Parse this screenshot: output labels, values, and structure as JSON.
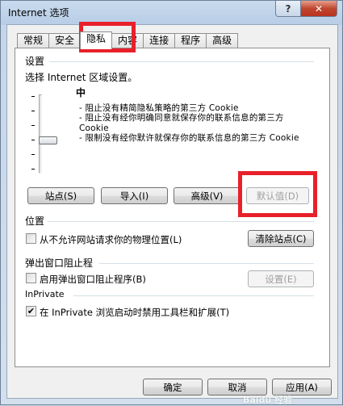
{
  "window": {
    "title": "Internet 选项",
    "help_label": "?",
    "close_label": "✕"
  },
  "tabs": [
    {
      "label": "常规"
    },
    {
      "label": "安全"
    },
    {
      "label": "隐私",
      "active": true
    },
    {
      "label": "内容"
    },
    {
      "label": "连接"
    },
    {
      "label": "程序"
    },
    {
      "label": "高级"
    }
  ],
  "settings": {
    "heading": "设置",
    "zone_prompt": "选择 Internet 区域设置。",
    "level": "中",
    "description": [
      "- 阻止没有精简隐私策略的第三方 Cookie",
      "- 阻止没有经你明确同意就保存你的联系信息的第三方 Cookie",
      "- 限制没有经你默许就保存你的联系信息的第三方 Cookie"
    ],
    "buttons": {
      "sites": "站点(S)",
      "import": "导入(I)",
      "advanced": "高级(V)",
      "default": "默认值(D)"
    }
  },
  "location": {
    "heading": "位置",
    "checkbox_label": "从不允许网站请求你的物理位置(L)",
    "checked": false,
    "clear_button": "清除站点(C)"
  },
  "popup": {
    "heading": "弹出窗口阻止程",
    "checkbox_label": "启用弹出窗口阻止程序(B)",
    "checked": false,
    "settings_button": "设置(E)"
  },
  "inprivate": {
    "heading": "InPrivate",
    "checkbox_label": "在 InPrivate 浏览启动时禁用工具栏和扩展(T)",
    "checked": true
  },
  "footer": {
    "ok": "确定",
    "cancel": "取消",
    "apply": "应用(A)"
  },
  "watermark": "Baidu 经验",
  "colors": {
    "highlight": "#e8202a",
    "panel_bg": "#ffffff",
    "dialog_bg": "#f0f0f0"
  }
}
